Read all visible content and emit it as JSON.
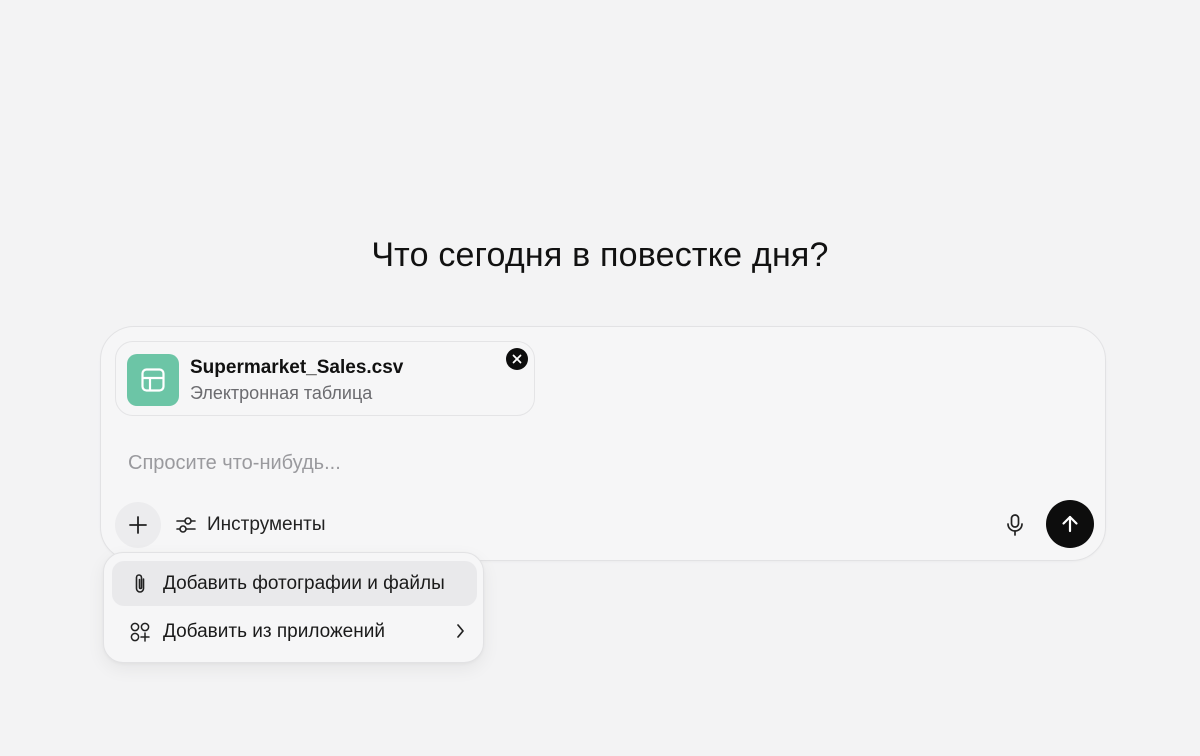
{
  "headline": "Что сегодня в повестке дня?",
  "attachment": {
    "file_name": "Supermarket_Sales.csv",
    "file_type": "Электронная таблица",
    "thumb_icon": "spreadsheet-icon",
    "thumb_color": "#6cc5a6"
  },
  "composer": {
    "placeholder": "Спросите что-нибудь...",
    "tools_label": "Инструменты"
  },
  "menu": {
    "items": [
      {
        "label": "Добавить фотографии и файлы",
        "icon": "paperclip-icon"
      },
      {
        "label": "Добавить из приложений",
        "icon": "apps-icon"
      }
    ]
  },
  "colors": {
    "background": "#f3f3f4",
    "send_button": "#0d0d0d"
  }
}
